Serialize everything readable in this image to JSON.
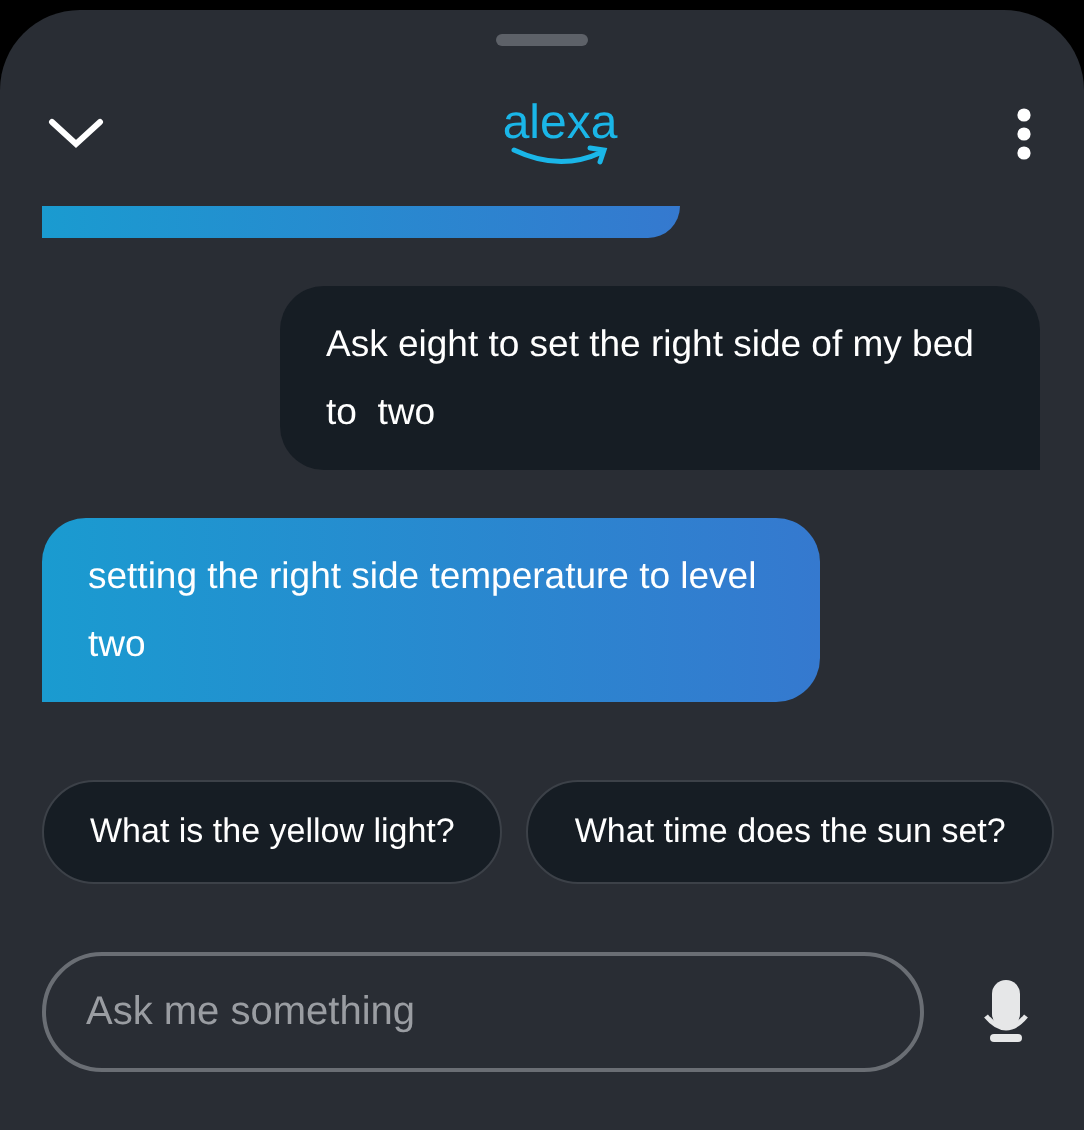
{
  "header": {
    "logo": "alexa"
  },
  "messages": [
    {
      "kind": "user",
      "text": "Ask eight to set the right side of my bed to  two"
    },
    {
      "kind": "alexa",
      "text": "setting the right side temperature to level two"
    }
  ],
  "suggestions": [
    "What is the yellow light?",
    "What time does the sun set?"
  ],
  "input": {
    "placeholder": "Ask me something"
  }
}
